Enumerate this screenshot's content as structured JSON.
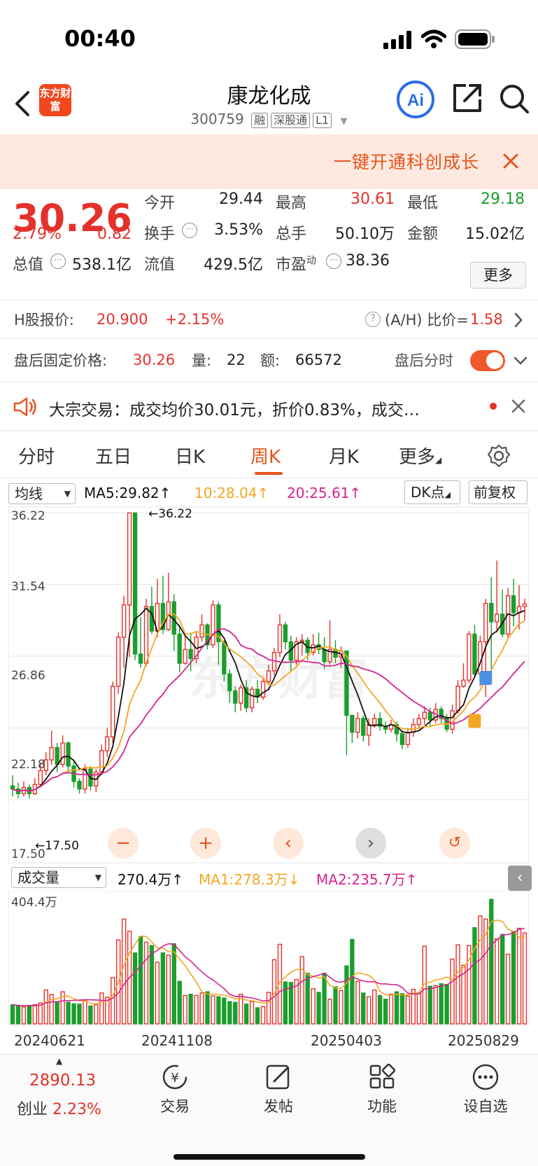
{
  "status_bar": {
    "time": "00:40"
  },
  "header": {
    "logo_text": "东方财富",
    "title": "康龙化成",
    "code": "300759",
    "tags": [
      "融",
      "深股通",
      "L1"
    ]
  },
  "promo": {
    "text": "一键开通科创成长"
  },
  "quote": {
    "price": "30.26",
    "change_pct": "2.79%",
    "change": "0.82",
    "fields": {
      "open_label": "今开",
      "open": "29.44",
      "high_label": "最高",
      "high": "30.61",
      "low_label": "最低",
      "low": "29.18",
      "turnover_label": "换手",
      "turnover": "3.53%",
      "volume_label": "总手",
      "volume": "50.10万",
      "amount_label": "金额",
      "amount": "15.02亿",
      "mktcap_label": "总值",
      "mktcap": "538.1亿",
      "float_label": "流值",
      "float": "429.5亿",
      "pe_label": "市盈",
      "pe_sup": "动",
      "pe": "38.36"
    },
    "more_label": "更多"
  },
  "hshare": {
    "label": "H股报价:",
    "price": "20.900",
    "change": "+2.15%",
    "ratio_label": "(A/H) 比价=",
    "ratio": "1.58"
  },
  "afterhours": {
    "label": "盘后固定价格:",
    "price": "30.26",
    "vol_label": "量:",
    "vol": "22",
    "amt_label": "额:",
    "amt": "66572",
    "toggle_label": "盘后分时",
    "toggle_on": true
  },
  "notice": {
    "text": "大宗交易：成交均价30.01元，折价0.83%，成交…"
  },
  "tabs": [
    {
      "label": "分时"
    },
    {
      "label": "五日"
    },
    {
      "label": "日K"
    },
    {
      "label": "周K",
      "active": true
    },
    {
      "label": "月K"
    },
    {
      "label": "更多"
    }
  ],
  "kline_legend": {
    "selector": "均线",
    "ma5": "MA5:29.82",
    "ma10": "10:28.04",
    "ma20": "20:25.61",
    "dk_label": "DK点",
    "adjust_label": "前复权"
  },
  "volume_legend": {
    "selector": "成交量",
    "vol": "270.4万",
    "ma1": "MA1:278.3万",
    "ma2": "MA2:235.7万"
  },
  "colors": {
    "up": "#e4312b",
    "down": "#1a9e2c",
    "accent": "#e8531e",
    "ma5": "#111111",
    "ma10": "#f5a623",
    "ma20": "#d6238f"
  },
  "chart_data": {
    "type": "candlestick",
    "y_ticks": [
      "36.22",
      "31.54",
      "26.86",
      "22.18",
      "17.50"
    ],
    "ylim": [
      17.5,
      36.22
    ],
    "max_annotation": "36.22",
    "min_annotation": "17.50",
    "volume_axis_max": "404.4万",
    "x_labels": [
      "20240621",
      "20241108",
      "20250403",
      "20250829"
    ],
    "candles": [
      [
        18.4,
        18.2,
        19.1,
        17.7
      ],
      [
        18.2,
        17.9,
        18.6,
        17.6
      ],
      [
        17.9,
        18.3,
        18.7,
        17.7
      ],
      [
        18.3,
        17.9,
        18.5,
        17.6
      ],
      [
        17.9,
        18.5,
        18.9,
        17.8
      ],
      [
        18.5,
        19.4,
        19.9,
        18.3
      ],
      [
        19.4,
        20.1,
        20.6,
        19.1
      ],
      [
        20.1,
        20.9,
        22.0,
        19.8
      ],
      [
        20.9,
        19.8,
        21.2,
        19.3
      ],
      [
        19.8,
        21.2,
        21.7,
        19.6
      ],
      [
        21.2,
        19.7,
        21.3,
        19.2
      ],
      [
        19.7,
        18.7,
        20.0,
        18.3
      ],
      [
        18.7,
        18.2,
        18.9,
        17.9
      ],
      [
        18.2,
        19.5,
        19.8,
        17.9
      ],
      [
        19.5,
        18.4,
        19.7,
        18.1
      ],
      [
        18.4,
        19.3,
        19.5,
        18.0
      ],
      [
        19.3,
        20.7,
        21.1,
        19.1
      ],
      [
        20.7,
        21.6,
        22.2,
        20.3
      ],
      [
        21.6,
        24.9,
        25.2,
        21.2
      ],
      [
        24.9,
        28.1,
        28.4,
        24.4
      ],
      [
        28.1,
        30.2,
        30.8,
        26.1
      ],
      [
        30.2,
        36.2,
        36.22,
        26.8
      ],
      [
        36.2,
        27.0,
        31.4,
        26.6
      ],
      [
        27.0,
        26.4,
        29.4,
        26.1
      ],
      [
        26.4,
        30.1,
        30.6,
        26.2
      ],
      [
        30.1,
        28.5,
        31.4,
        28.3
      ],
      [
        28.5,
        30.3,
        31.9,
        28.1
      ],
      [
        30.3,
        28.6,
        32.1,
        28.3
      ],
      [
        28.6,
        30.4,
        32.3,
        28.5
      ],
      [
        30.4,
        28.3,
        30.9,
        27.2
      ],
      [
        28.3,
        26.4,
        28.9,
        25.8
      ],
      [
        26.4,
        27.3,
        28.3,
        26.3
      ],
      [
        27.3,
        26.7,
        28.4,
        25.9
      ],
      [
        26.7,
        28.1,
        28.4,
        26.4
      ],
      [
        28.1,
        28.9,
        29.6,
        27.8
      ],
      [
        28.9,
        27.6,
        29.0,
        27.3
      ],
      [
        27.6,
        30.2,
        30.5,
        27.4
      ],
      [
        30.2,
        27.8,
        30.4,
        26.3
      ],
      [
        27.8,
        25.7,
        27.9,
        25.2
      ],
      [
        25.7,
        24.6,
        26.0,
        23.8
      ],
      [
        24.6,
        23.8,
        24.9,
        23.2
      ],
      [
        23.8,
        24.8,
        25.0,
        23.3
      ],
      [
        24.8,
        23.5,
        25.3,
        23.2
      ],
      [
        23.5,
        24.7,
        24.9,
        23.2
      ],
      [
        24.7,
        24.2,
        25.3,
        23.8
      ],
      [
        24.2,
        25.2,
        25.5,
        24.0
      ],
      [
        25.2,
        25.9,
        26.3,
        25.0
      ],
      [
        25.9,
        27.1,
        27.4,
        25.6
      ],
      [
        27.1,
        28.9,
        29.6,
        26.8
      ],
      [
        28.9,
        27.8,
        29.1,
        27.3
      ],
      [
        27.8,
        26.6,
        28.2,
        25.9
      ],
      [
        26.6,
        27.8,
        28.1,
        26.3
      ],
      [
        27.8,
        27.9,
        28.3,
        26.9
      ],
      [
        27.9,
        27.1,
        28.1,
        26.6
      ],
      [
        27.1,
        27.6,
        28.3,
        26.9
      ],
      [
        27.6,
        27.3,
        28.4,
        27.0
      ],
      [
        27.3,
        26.5,
        28.1,
        26.0
      ],
      [
        26.5,
        27.3,
        29.2,
        26.3
      ],
      [
        27.3,
        26.8,
        27.9,
        26.4
      ],
      [
        26.8,
        27.2,
        27.5,
        26.1
      ],
      [
        27.2,
        23.0,
        24.8,
        20.4
      ],
      [
        23.0,
        21.9,
        22.5,
        21.2
      ],
      [
        21.9,
        22.8,
        23.2,
        21.5
      ],
      [
        22.8,
        21.7,
        23.0,
        21.3
      ],
      [
        21.7,
        22.4,
        22.8,
        21.0
      ],
      [
        22.4,
        22.8,
        23.1,
        22.2
      ],
      [
        22.8,
        22.3,
        23.2,
        22.0
      ],
      [
        22.3,
        22.1,
        22.6,
        21.8
      ],
      [
        22.1,
        22.4,
        22.7,
        21.9
      ],
      [
        22.4,
        21.8,
        22.6,
        21.3
      ],
      [
        21.8,
        21.1,
        22.0,
        20.8
      ],
      [
        21.1,
        21.9,
        22.1,
        20.9
      ],
      [
        21.9,
        22.4,
        22.8,
        21.6
      ],
      [
        22.4,
        22.8,
        23.1,
        22.1
      ],
      [
        22.8,
        23.2,
        23.6,
        22.4
      ],
      [
        23.2,
        22.7,
        23.5,
        22.3
      ],
      [
        22.7,
        23.4,
        23.8,
        22.5
      ],
      [
        23.4,
        22.8,
        23.6,
        22.5
      ],
      [
        22.8,
        22.1,
        23.1,
        21.9
      ],
      [
        22.1,
        23.3,
        23.7,
        21.8
      ],
      [
        23.3,
        24.9,
        25.3,
        23.1
      ],
      [
        24.9,
        25.3,
        26.4,
        24.8
      ],
      [
        25.3,
        28.3,
        28.5,
        25.1
      ],
      [
        28.3,
        25.7,
        28.9,
        25.5
      ],
      [
        25.7,
        27.8,
        28.2,
        24.9
      ],
      [
        27.8,
        30.3,
        30.6,
        24.2
      ],
      [
        30.3,
        29.1,
        32.0,
        25.4
      ],
      [
        29.1,
        29.6,
        33.1,
        28.4
      ],
      [
        29.6,
        28.3,
        31.2,
        28.1
      ],
      [
        28.3,
        30.8,
        31.3,
        28.0
      ],
      [
        30.8,
        29.7,
        31.9,
        28.8
      ],
      [
        29.7,
        30.1,
        31.5,
        28.6
      ],
      [
        30.1,
        30.26,
        30.61,
        29.18
      ]
    ],
    "volumes": [
      62,
      58,
      55,
      60,
      62,
      68,
      110,
      95,
      72,
      104,
      70,
      65,
      64,
      74,
      58,
      62,
      100,
      86,
      150,
      272,
      340,
      300,
      230,
      282,
      265,
      254,
      200,
      230,
      223,
      260,
      138,
      92,
      96,
      92,
      100,
      104,
      90,
      88,
      84,
      72,
      70,
      96,
      64,
      72,
      52,
      56,
      102,
      208,
      258,
      136,
      134,
      144,
      218,
      164,
      114,
      102,
      164,
      80,
      120,
      108,
      188,
      274,
      138,
      100,
      88,
      110,
      92,
      80,
      96,
      104,
      98,
      90,
      112,
      100,
      252,
      122,
      124,
      130,
      128,
      210,
      256,
      190,
      254,
      312,
      350,
      340,
      404,
      276,
      290,
      226,
      300,
      310,
      295
    ],
    "volume_unit": "万"
  }
}
